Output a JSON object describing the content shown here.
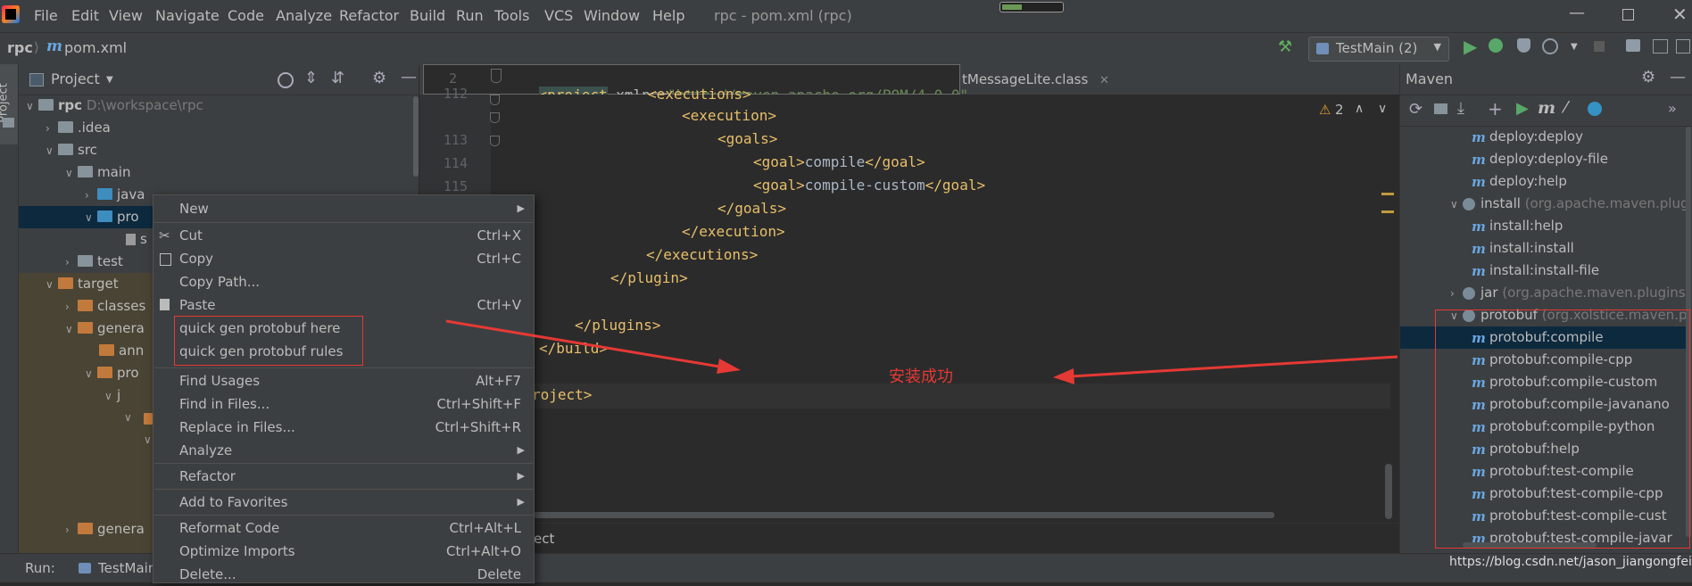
{
  "menubar": {
    "items": [
      "File",
      "Edit",
      "View",
      "Navigate",
      "Code",
      "Analyze",
      "Refactor",
      "Build",
      "Run",
      "Tools",
      "VCS",
      "Window",
      "Help"
    ],
    "title": "rpc - pom.xml (rpc)"
  },
  "navbar": {
    "project": "rpc",
    "file": "pom.xml",
    "run_config": "TestMain (2)"
  },
  "left_strip": {
    "label": "Project"
  },
  "project_panel": {
    "title": "Project",
    "tree": [
      {
        "label": "rpc",
        "path": "D:\\workspace\\rpc"
      },
      {
        "label": ".idea"
      },
      {
        "label": "src"
      },
      {
        "label": "main"
      },
      {
        "label": "java"
      },
      {
        "label": "pro"
      },
      {
        "label": "s"
      },
      {
        "label": "test"
      },
      {
        "label": "target"
      },
      {
        "label": "classes"
      },
      {
        "label": "genera"
      },
      {
        "label": "ann"
      },
      {
        "label": "pro"
      },
      {
        "label": "j"
      },
      {
        "label": "genera"
      }
    ]
  },
  "editor": {
    "tab_suffix": "tMessageLite.class",
    "tooltip_line": "2",
    "tooltip_code_tag": "<project",
    "tooltip_code_attr": " xmlns=",
    "tooltip_code_value": "\"http://maven.apache.org/POM/4.0.0\"",
    "warnings": "2",
    "lines": [
      "112",
      "113",
      "114",
      "115"
    ],
    "code": {
      "l0": "<executions>",
      "l1": "<execution>",
      "l2": "<goals>",
      "l3": "<goal>",
      "l3_text": "compile",
      "l3_end": "</goal>",
      "l4": "<goal>",
      "l4_text": "compile-custom",
      "l4_end": "</goal>",
      "l5": "</goals>",
      "l6": "</execution>",
      "l7": "</executions>",
      "l8": "</plugin>",
      "l9": "</plugins>",
      "l10": "</build>",
      "l11": "roject>"
    },
    "breadcrumb": "ect",
    "annotation": "安装成功"
  },
  "context_menu": {
    "items": [
      {
        "label": "New",
        "shortcut": ""
      },
      {
        "label": "Cut",
        "shortcut": "Ctrl+X"
      },
      {
        "label": "Copy",
        "shortcut": "Ctrl+C"
      },
      {
        "label": "Copy Path...",
        "shortcut": ""
      },
      {
        "label": "Paste",
        "shortcut": "Ctrl+V"
      },
      {
        "label": "quick gen protobuf here",
        "shortcut": ""
      },
      {
        "label": "quick gen protobuf rules",
        "shortcut": ""
      },
      {
        "label": "Find Usages",
        "shortcut": "Alt+F7"
      },
      {
        "label": "Find in Files...",
        "shortcut": "Ctrl+Shift+F"
      },
      {
        "label": "Replace in Files...",
        "shortcut": "Ctrl+Shift+R"
      },
      {
        "label": "Analyze",
        "shortcut": ""
      },
      {
        "label": "Refactor",
        "shortcut": ""
      },
      {
        "label": "Add to Favorites",
        "shortcut": ""
      },
      {
        "label": "Reformat Code",
        "shortcut": "Ctrl+Alt+L"
      },
      {
        "label": "Optimize Imports",
        "shortcut": "Ctrl+Alt+O"
      },
      {
        "label": "Delete...",
        "shortcut": "Delete"
      }
    ]
  },
  "maven_panel": {
    "title": "Maven",
    "rows": [
      {
        "label": "deploy:deploy"
      },
      {
        "label": "deploy:deploy-file"
      },
      {
        "label": "deploy:help"
      },
      {
        "label": "install",
        "extra": "(org.apache.maven.plug"
      },
      {
        "label": "install:help"
      },
      {
        "label": "install:install"
      },
      {
        "label": "install:install-file"
      },
      {
        "label": "jar",
        "extra": "(org.apache.maven.plugins:"
      },
      {
        "label": "protobuf",
        "extra": "(org.xolstice.maven.p"
      },
      {
        "label": "protobuf:compile"
      },
      {
        "label": "protobuf:compile-cpp"
      },
      {
        "label": "protobuf:compile-custom"
      },
      {
        "label": "protobuf:compile-javanano"
      },
      {
        "label": "protobuf:compile-python"
      },
      {
        "label": "protobuf:help"
      },
      {
        "label": "protobuf:test-compile"
      },
      {
        "label": "protobuf:test-compile-cpp"
      },
      {
        "label": "protobuf:test-compile-cust"
      },
      {
        "label": "protobuf:test-compile-javar"
      }
    ]
  },
  "bottom": {
    "run_label": "Run:",
    "run_tab": "TestMain",
    "watermark": "https://blog.csdn.net/jason_jiangongfei"
  },
  "colors": {
    "accent_red": "#e53935",
    "selection": "#0d293e",
    "tag": "#e8bf6a",
    "attr_value": "#6a8759"
  }
}
